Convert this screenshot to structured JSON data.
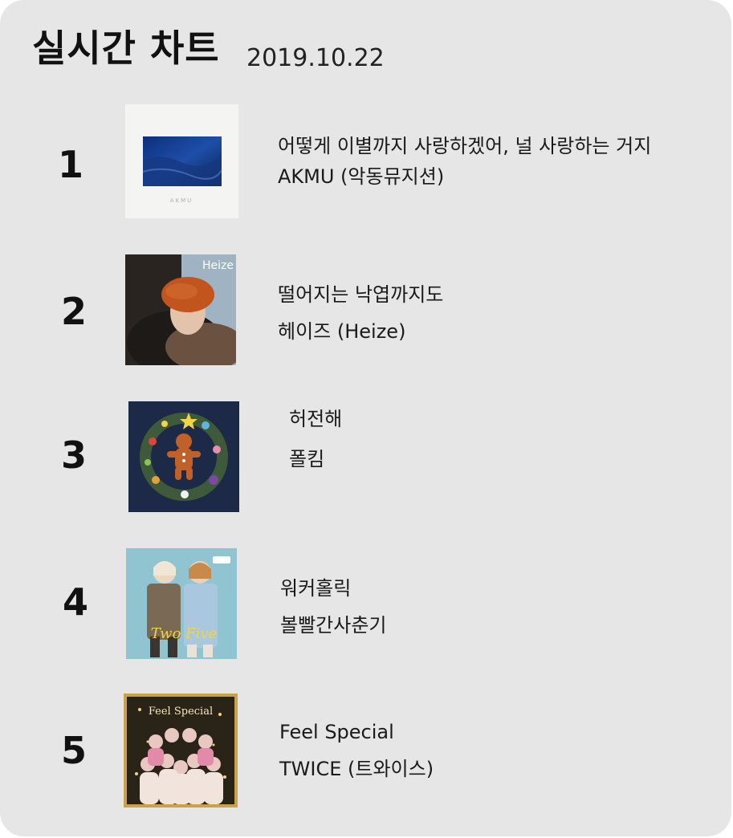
{
  "header": {
    "title": "실시간 차트",
    "date": "2019.10.22"
  },
  "chart": [
    {
      "rank": "1",
      "song": "어떻게 이별까지 사랑하겠어, 널 사랑하는 거지",
      "artist": "AKMU (악동뮤지션)",
      "cover_text": "AKMU"
    },
    {
      "rank": "2",
      "song": "떨어지는 낙엽까지도",
      "artist": "헤이즈 (Heize)",
      "cover_text": "Heize"
    },
    {
      "rank": "3",
      "song": "허전해",
      "artist": "폴킴"
    },
    {
      "rank": "4",
      "song": "워커홀릭",
      "artist": "볼빨간사춘기",
      "cover_text": "Two Five"
    },
    {
      "rank": "5",
      "song": "Feel Special",
      "artist": "TWICE (트와이스)",
      "cover_text": "Feel Special"
    }
  ],
  "colors": {
    "background": "#e6e6e6",
    "text": "#111111"
  }
}
